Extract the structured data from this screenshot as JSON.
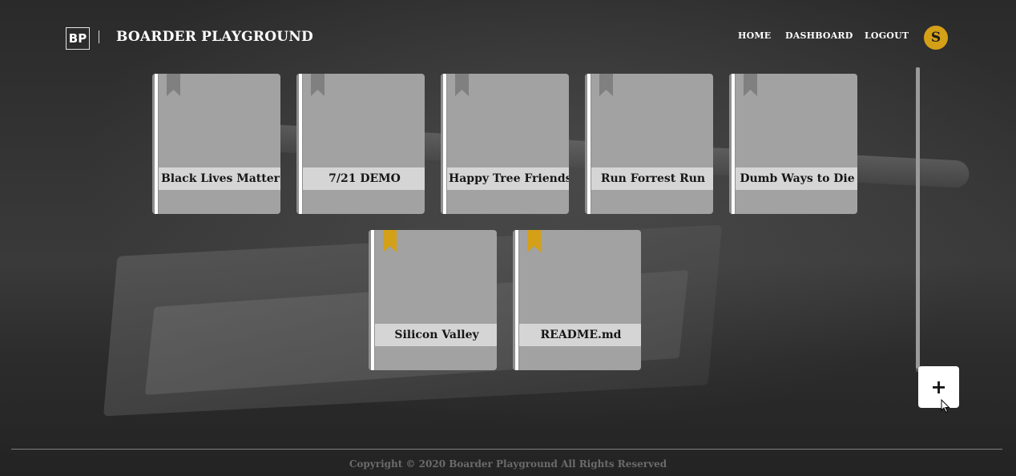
{
  "header": {
    "logo": "BP",
    "brand": "BOARDER PLAYGROUND",
    "nav": [
      "HOME",
      "DASHBOARD",
      "LOGOUT"
    ],
    "avatar_initial": "S"
  },
  "boards": [
    {
      "title": "Black Lives Matter",
      "bookmark": "gray"
    },
    {
      "title": "7/21 DEMO",
      "bookmark": "gray"
    },
    {
      "title": "Happy Tree Friends",
      "bookmark": "gray"
    },
    {
      "title": "Run Forrest Run",
      "bookmark": "gray"
    },
    {
      "title": "Dumb Ways to Die",
      "bookmark": "gray"
    },
    {
      "title": "Silicon Valley",
      "bookmark": "gold"
    },
    {
      "title": "README.md",
      "bookmark": "gold"
    }
  ],
  "add_button": {
    "symbol": "+"
  },
  "footer": {
    "copyright": "Copyright © 2020 Boarder Playground All Rights Reserved"
  },
  "colors": {
    "accent_gold": "#d4a017",
    "bookmark_gray": "#808080",
    "bookmark_gold": "#d4a017",
    "card_bg": "#a2a2a2"
  }
}
